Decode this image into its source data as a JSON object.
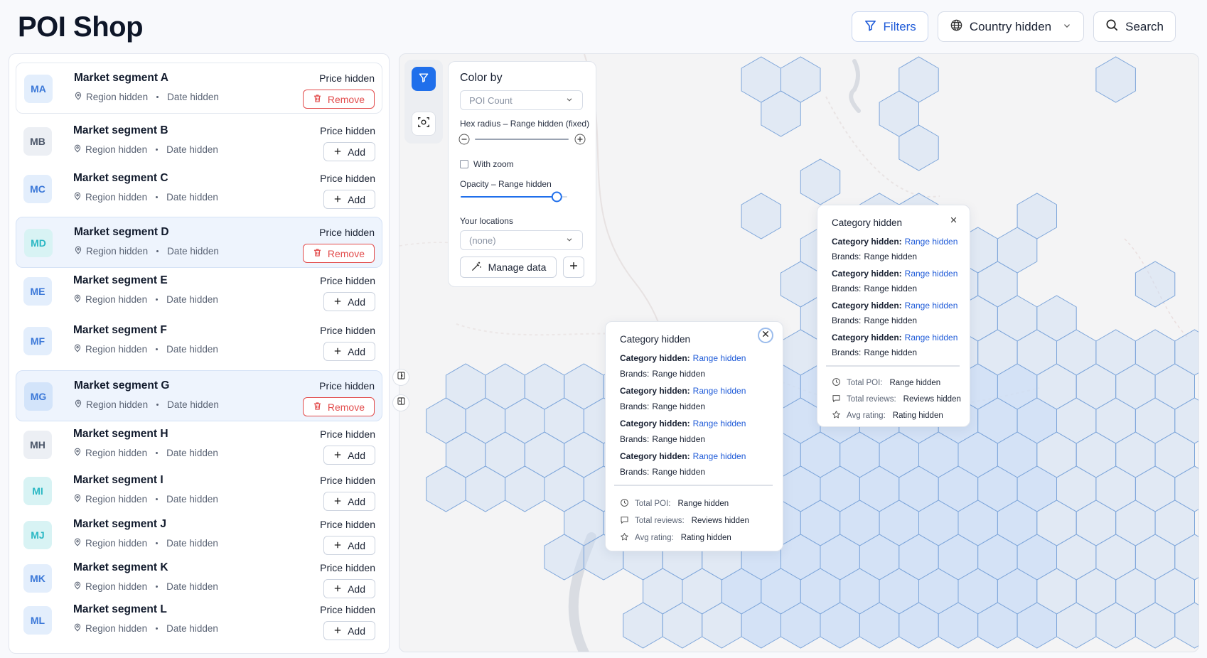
{
  "app": {
    "title": "POI Shop"
  },
  "topbar": {
    "filters_label": "Filters",
    "country_label": "Country hidden",
    "search_label": "Search"
  },
  "segments": [
    {
      "initials": "MA",
      "name": "Market segment A",
      "region": "Region hidden",
      "date": "Date hidden",
      "price": "Price hidden",
      "action": "Remove",
      "avatar_bg": "#e3eefc",
      "avatar_fg": "#3b78d8",
      "state": "first"
    },
    {
      "initials": "MB",
      "name": "Market segment B",
      "region": "Region hidden",
      "date": "Date hidden",
      "price": "Price hidden",
      "action": "Add",
      "avatar_bg": "#eceff4",
      "avatar_fg": "#4a5568",
      "state": ""
    },
    {
      "initials": "MC",
      "name": "Market segment C",
      "region": "Region hidden",
      "date": "Date hidden",
      "price": "Price hidden",
      "action": "Add",
      "avatar_bg": "#e3eefc",
      "avatar_fg": "#3b78d8",
      "state": ""
    },
    {
      "initials": "MD",
      "name": "Market segment D",
      "region": "Region hidden",
      "date": "Date hidden",
      "price": "Price hidden",
      "action": "Remove",
      "avatar_bg": "#d8f3f4",
      "avatar_fg": "#2bb8c4",
      "state": "selected"
    },
    {
      "initials": "ME",
      "name": "Market segment E",
      "region": "Region hidden",
      "date": "Date hidden",
      "price": "Price hidden",
      "action": "Add",
      "avatar_bg": "#e3eefc",
      "avatar_fg": "#3b78d8",
      "state": ""
    },
    {
      "initials": "MF",
      "name": "Market segment F",
      "region": "Region hidden",
      "date": "Date hidden",
      "price": "Price hidden",
      "action": "Add",
      "avatar_bg": "#e3eefc",
      "avatar_fg": "#3b78d8",
      "state": ""
    },
    {
      "initials": "MG",
      "name": "Market segment G",
      "region": "Region hidden",
      "date": "Date hidden",
      "price": "Price hidden",
      "action": "Remove",
      "avatar_bg": "#d3e4fa",
      "avatar_fg": "#3b78d8",
      "state": "selected"
    },
    {
      "initials": "MH",
      "name": "Market segment H",
      "region": "Region hidden",
      "date": "Date hidden",
      "price": "Price hidden",
      "action": "Add",
      "avatar_bg": "#eceff4",
      "avatar_fg": "#4a5568",
      "state": ""
    },
    {
      "initials": "MI",
      "name": "Market segment I",
      "region": "Region hidden",
      "date": "Date hidden",
      "price": "Price hidden",
      "action": "Add",
      "avatar_bg": "#d8f3f4",
      "avatar_fg": "#2bb8c4",
      "state": ""
    },
    {
      "initials": "MJ",
      "name": "Market segment J",
      "region": "Region hidden",
      "date": "Date hidden",
      "price": "Price hidden",
      "action": "Add",
      "avatar_bg": "#d8f3f4",
      "avatar_fg": "#2bb8c4",
      "state": ""
    },
    {
      "initials": "MK",
      "name": "Market segment K",
      "region": "Region hidden",
      "date": "Date hidden",
      "price": "Price hidden",
      "action": "Add",
      "avatar_bg": "#e3eefc",
      "avatar_fg": "#3b78d8",
      "state": ""
    },
    {
      "initials": "ML",
      "name": "Market segment L",
      "region": "Region hidden",
      "date": "Date hidden",
      "price": "Price hidden",
      "action": "Add",
      "avatar_bg": "#e3eefc",
      "avatar_fg": "#3b78d8",
      "state": ""
    }
  ],
  "color_panel": {
    "title": "Color by",
    "color_by_value": "POI Count",
    "hex_radius_label": "Hex radius – Range hidden (fixed)",
    "hex_radius_level": 1.0,
    "with_zoom_label": "With zoom",
    "with_zoom_checked": false,
    "opacity_label": "Opacity – Range hidden",
    "opacity_level": 0.85,
    "your_locations_label": "Your locations",
    "your_locations_value": "(none)",
    "manage_data_label": "Manage data"
  },
  "popup_left": {
    "title": "Category hidden",
    "rows": [
      {
        "category": "Category hidden:",
        "range": "Range hidden",
        "brands_label": "Brands:",
        "brands_value": "Range hidden"
      },
      {
        "category": "Category hidden:",
        "range": "Range hidden",
        "brands_label": "Brands:",
        "brands_value": "Range hidden"
      },
      {
        "category": "Category hidden:",
        "range": "Range hidden",
        "brands_label": "Brands:",
        "brands_value": "Range hidden"
      },
      {
        "category": "Category hidden:",
        "range": "Range hidden",
        "brands_label": "Brands:",
        "brands_value": "Range hidden"
      }
    ],
    "total_poi_label": "Total POI:",
    "total_poi_value": "Range hidden",
    "total_reviews_label": "Total reviews:",
    "total_reviews_value": "Reviews hidden",
    "avg_rating_label": "Avg rating:",
    "avg_rating_value": "Rating hidden"
  },
  "popup_right": {
    "title": "Category hidden",
    "rows": [
      {
        "category": "Category hidden:",
        "range": "Range hidden",
        "brands_label": "Brands:",
        "brands_value": "Range hidden"
      },
      {
        "category": "Category hidden:",
        "range": "Range hidden",
        "brands_label": "Brands:",
        "brands_value": "Range hidden"
      },
      {
        "category": "Category hidden:",
        "range": "Range hidden",
        "brands_label": "Brands:",
        "brands_value": "Range hidden"
      },
      {
        "category": "Category hidden:",
        "range": "Range hidden",
        "brands_label": "Brands:",
        "brands_value": "Range hidden"
      }
    ],
    "total_poi_label": "Total POI:",
    "total_poi_value": "Range hidden",
    "total_reviews_label": "Total reviews:",
    "total_reviews_value": "Reviews hidden",
    "avg_rating_label": "Avg rating:",
    "avg_rating_value": "Rating hidden"
  },
  "colors": {
    "accent": "#1f6feb",
    "remove": "#e24b4b",
    "hex_fill": "#c9dcf5",
    "hex_stroke": "#7ea6da"
  }
}
